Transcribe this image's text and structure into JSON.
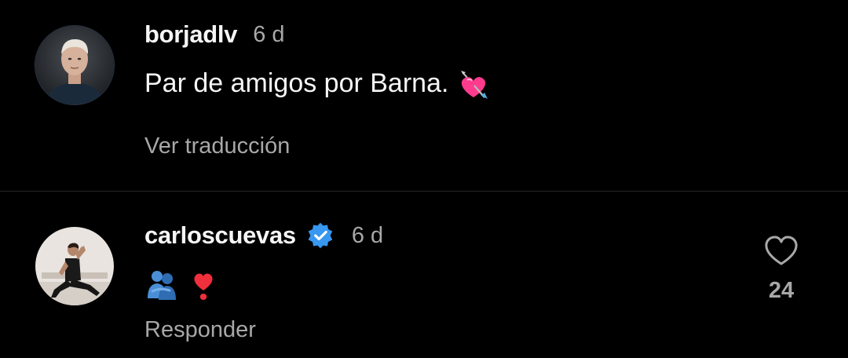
{
  "comments": [
    {
      "username": "borjadlv",
      "time": "6 d",
      "text": "Par de amigos por Barna.",
      "emoji": "heart-with-arrow",
      "action": "Ver traducción"
    },
    {
      "username": "carloscuevas",
      "verified": true,
      "time": "6 d",
      "emoji": [
        "people-hugging",
        "heart-exclamation"
      ],
      "action": "Responder",
      "likes": "24"
    }
  ],
  "colors": {
    "background": "#000000",
    "primary_text": "#f5f5f5",
    "secondary_text": "#a8a8a8",
    "verified_blue": "#3897f0",
    "divider": "#262626"
  }
}
